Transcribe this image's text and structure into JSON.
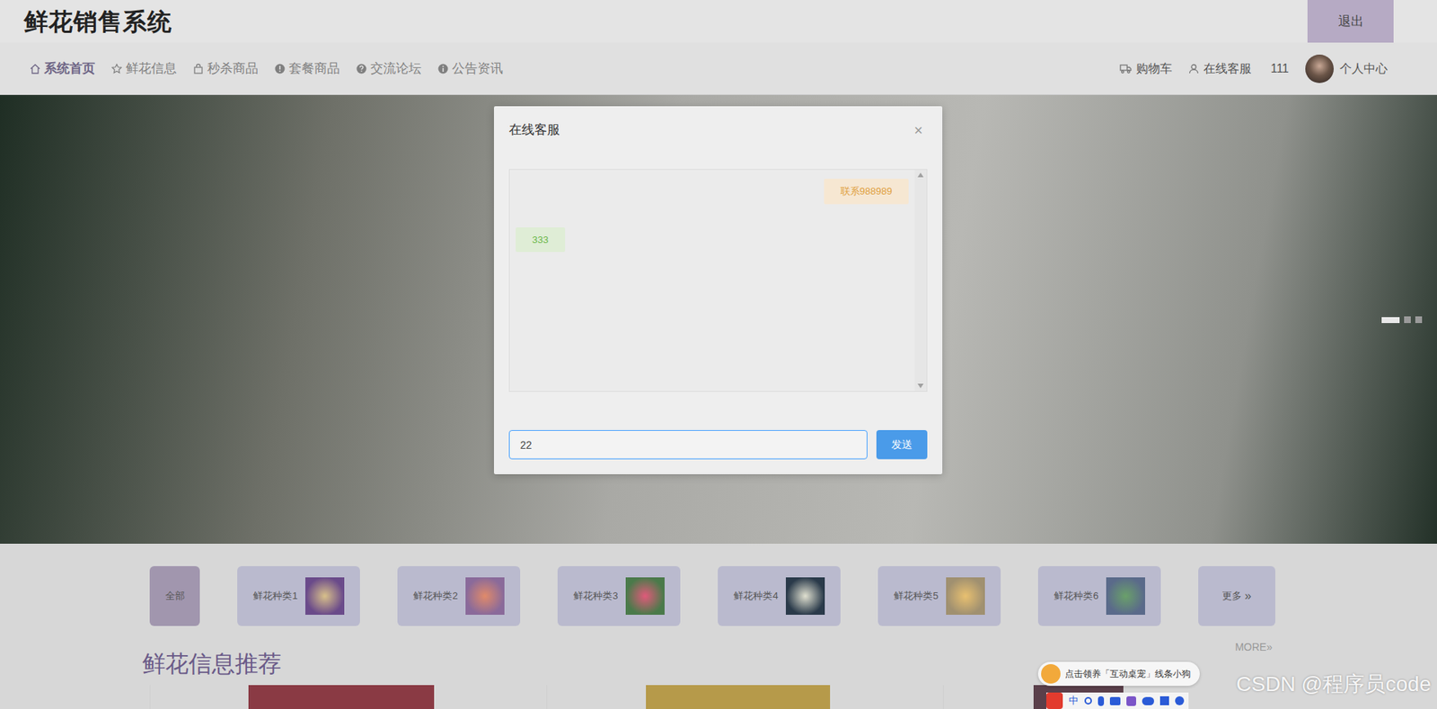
{
  "header": {
    "title": "鲜花销售系统",
    "logout": "退出"
  },
  "nav": {
    "items": [
      {
        "label": "系统首页",
        "selected": true
      },
      {
        "label": "鲜花信息",
        "selected": false
      },
      {
        "label": "秒杀商品",
        "selected": false
      },
      {
        "label": "套餐商品",
        "selected": false
      },
      {
        "label": "交流论坛",
        "selected": false
      },
      {
        "label": "公告资讯",
        "selected": false
      }
    ],
    "cart": "购物车",
    "service": "在线客服",
    "username": "111",
    "profile": "个人中心"
  },
  "banner": {
    "slides": [
      {
        "selected": true
      },
      {
        "selected": false
      },
      {
        "selected": false
      }
    ]
  },
  "categories": [
    {
      "label": "全部",
      "kind": "all",
      "selected": true
    },
    {
      "label": "鲜花种类1",
      "kind": "thumb",
      "selected": false
    },
    {
      "label": "鲜花种类2",
      "kind": "thumb",
      "selected": false
    },
    {
      "label": "鲜花种类3",
      "kind": "thumb",
      "selected": false
    },
    {
      "label": "鲜花种类4",
      "kind": "thumb",
      "selected": false
    },
    {
      "label": "鲜花种类5",
      "kind": "thumb",
      "selected": false
    },
    {
      "label": "鲜花种类6",
      "kind": "thumb",
      "selected": false
    },
    {
      "label": "更多",
      "arrow": "»",
      "kind": "more",
      "selected": false
    }
  ],
  "section": {
    "title": "鲜花信息推荐",
    "more": "MORE»"
  },
  "dialog": {
    "title": "在线客服",
    "close": "×",
    "messages": [
      {
        "text": "联系988989",
        "kind": "sent"
      },
      {
        "text": "333",
        "kind": "received"
      }
    ],
    "input": {
      "value": "22"
    },
    "send": "发送"
  },
  "ime": {
    "tip": "点击领养「互动桌宠」线条小狗",
    "lang": "中"
  },
  "watermark": "CSDN @程序员code"
}
